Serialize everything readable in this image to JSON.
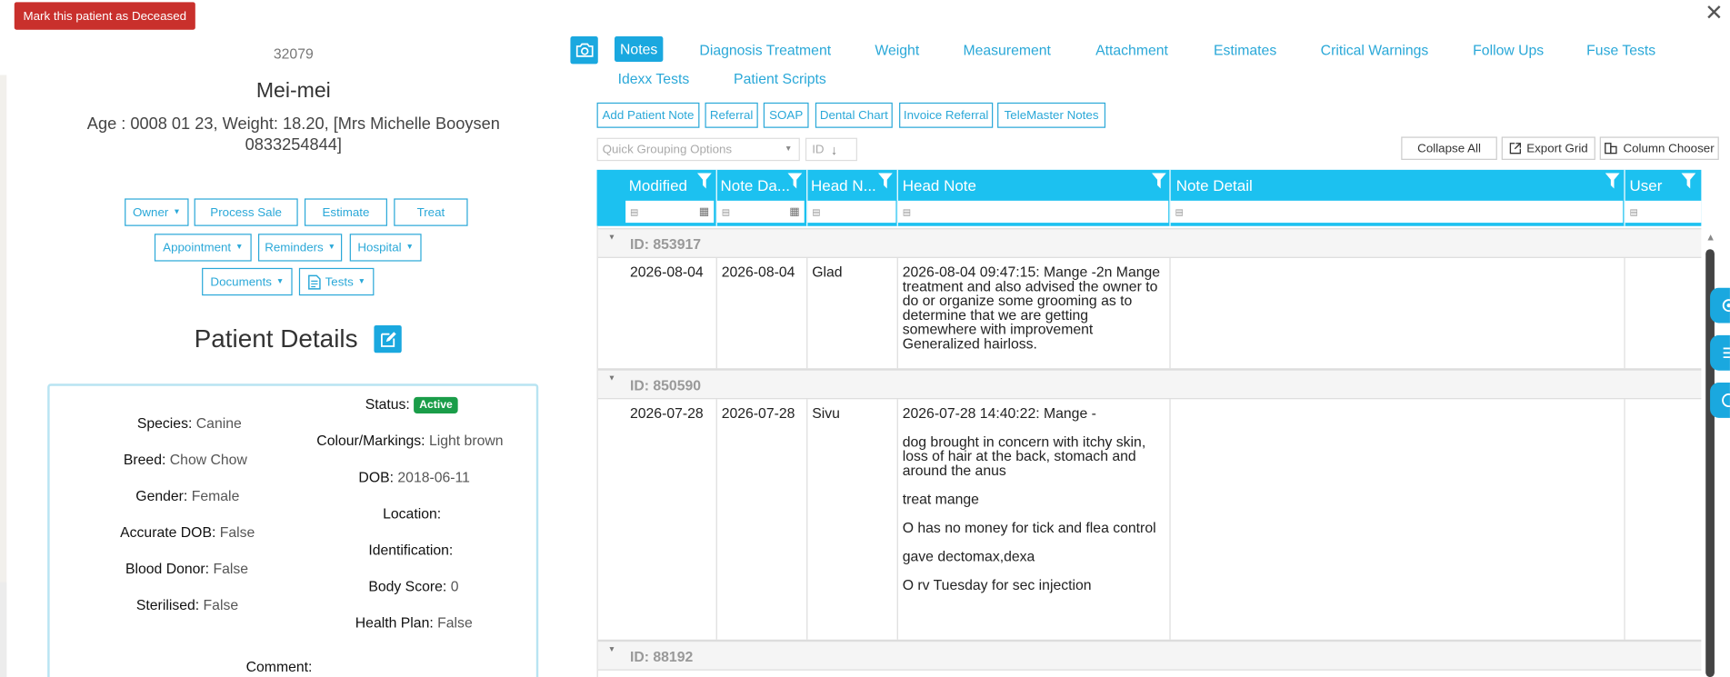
{
  "header": {
    "deceased_button": "Mark this patient as Deceased",
    "close": "✕"
  },
  "patient": {
    "id": "32079",
    "name": "Mei-mei",
    "info": "Age : 0008 01 23, Weight: 18.20, [Mrs Michelle Booysen 0833254844]"
  },
  "actions": {
    "owner": "Owner",
    "process_sale": "Process Sale",
    "estimate": "Estimate",
    "treat": "Treat",
    "appointment": "Appointment",
    "reminders": "Reminders",
    "hospital": "Hospital",
    "documents": "Documents",
    "tests": "Tests"
  },
  "details": {
    "title": "Patient Details",
    "species_label": "Species:",
    "species": "Canine",
    "breed_label": "Breed:",
    "breed": "Chow Chow",
    "gender_label": "Gender:",
    "gender": "Female",
    "accurate_dob_label": "Accurate DOB:",
    "accurate_dob": "False",
    "blood_donor_label": "Blood Donor:",
    "blood_donor": "False",
    "sterilised_label": "Sterilised:",
    "sterilised": "False",
    "comment_label": "Comment:",
    "status_label": "Status:",
    "status": "Active",
    "colour_label": "Colour/Markings:",
    "colour": "Light brown",
    "dob_label": "DOB:",
    "dob": "2018-06-11",
    "location_label": "Location:",
    "identification_label": "Identification:",
    "body_score_label": "Body Score:",
    "body_score": "0",
    "health_plan_label": "Health Plan:",
    "health_plan": "False",
    "status_color": "#1a9d49"
  },
  "tabs": [
    "Notes",
    "Diagnosis Treatment",
    "Weight",
    "Measurement",
    "Attachment",
    "Estimates",
    "Critical Warnings",
    "Follow Ups",
    "Fuse Tests",
    "Idexx Tests",
    "Patient Scripts"
  ],
  "note_actions": [
    "Add Patient Note",
    "Referral",
    "SOAP",
    "Dental Chart",
    "Invoice Referral",
    "TeleMaster Notes"
  ],
  "grid_toolbar": {
    "grouping_placeholder": "Quick Grouping Options",
    "sort_field": "ID",
    "collapse_all": "Collapse All",
    "export_grid": "Export Grid",
    "column_chooser": "Column Chooser"
  },
  "grid": {
    "columns": [
      "Modified",
      "Note Da...",
      "Head N...",
      "Head Note",
      "Note Detail",
      "User"
    ],
    "header_color": "#1cc1f0",
    "groups": [
      {
        "label": "ID: 853917",
        "modified": "2026-08-04",
        "note_date": "2026-08-04",
        "head_name": "Glad",
        "head_note": [
          "2026-08-04 09:47:15: Mange -2n Mange treatment and also advised the owner to do or organize some grooming as to determine that we are getting somewhere with improvement Generalized hairloss."
        ]
      },
      {
        "label": "ID: 850590",
        "modified": "2026-07-28",
        "note_date": "2026-07-28",
        "head_name": "Sivu",
        "head_note": [
          "2026-07-28 14:40:22: Mange -",
          "dog brought in concern with itchy skin, loss of hair at the back, stomach and around the anus",
          "treat mange",
          "O has no money for tick and flea control",
          "gave dectomax,dexa",
          "O rv Tuesday for sec injection"
        ]
      },
      {
        "label": "ID: 88192"
      }
    ]
  }
}
